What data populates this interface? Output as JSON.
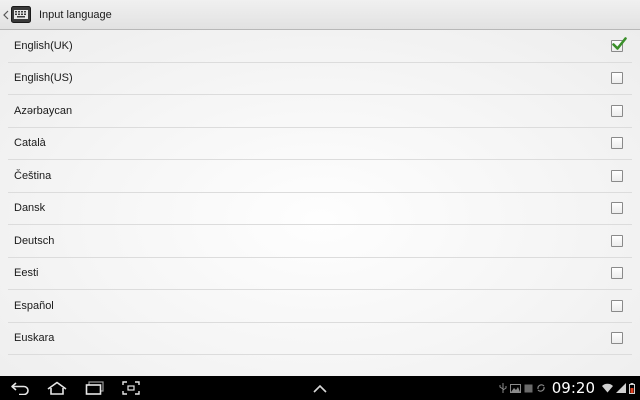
{
  "header": {
    "title": "Input language",
    "back_icon": "chevron-left-icon",
    "app_icon": "keyboard-icon"
  },
  "languages": [
    {
      "label": "English(UK)",
      "checked": true
    },
    {
      "label": "English(US)",
      "checked": false
    },
    {
      "label": "Azərbaycan",
      "checked": false
    },
    {
      "label": "Català",
      "checked": false
    },
    {
      "label": "Čeština",
      "checked": false
    },
    {
      "label": "Dansk",
      "checked": false
    },
    {
      "label": "Deutsch",
      "checked": false
    },
    {
      "label": "Eesti",
      "checked": false
    },
    {
      "label": "Español",
      "checked": false
    },
    {
      "label": "Euskara",
      "checked": false
    }
  ],
  "navigation": {
    "buttons": [
      "back-icon",
      "home-icon",
      "recent-apps-icon",
      "screenshot-icon",
      "chevron-up-icon"
    ]
  },
  "status_bar": {
    "time": "09:20",
    "icons": [
      "usb-icon",
      "gallery-icon",
      "notification-icon",
      "sync-icon",
      "wifi-icon",
      "signal-icon",
      "battery-icon"
    ]
  },
  "colors": {
    "accent_check": "#3a8f2a",
    "nav_background": "#000000"
  }
}
